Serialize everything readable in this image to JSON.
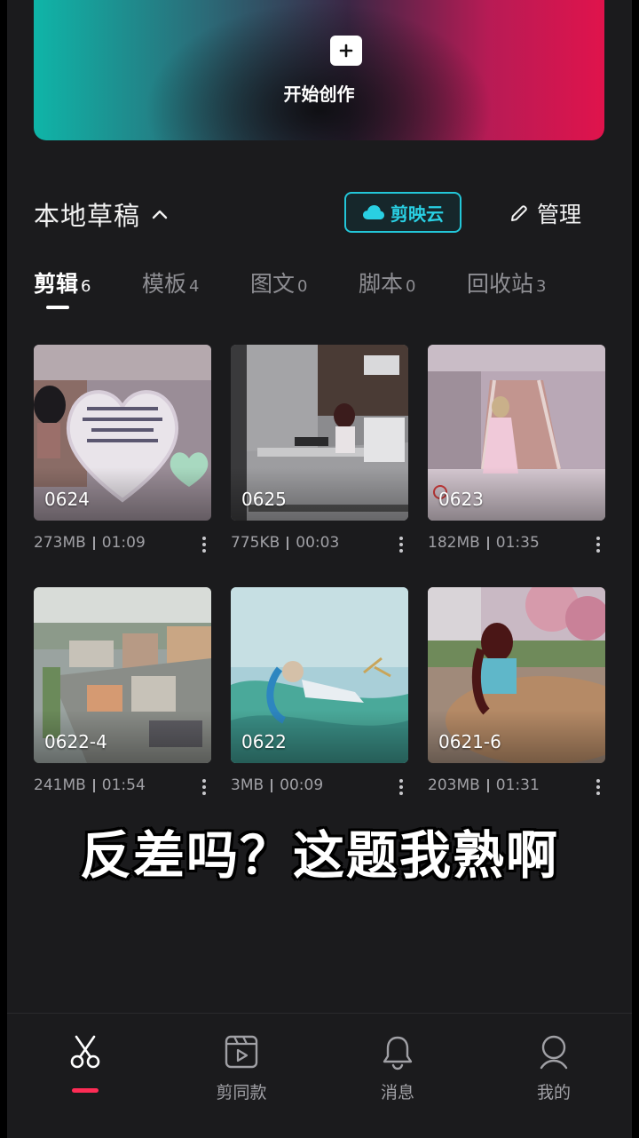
{
  "hero": {
    "label": "开始创作",
    "icon": "plus-icon"
  },
  "section": {
    "title": "本地草稿",
    "cloud_label": "剪映云",
    "manage_label": "管理"
  },
  "tabs": [
    {
      "label": "剪辑",
      "count": "6",
      "active": true
    },
    {
      "label": "模板",
      "count": "4"
    },
    {
      "label": "图文",
      "count": "0"
    },
    {
      "label": "脚本",
      "count": "0"
    },
    {
      "label": "回收站",
      "count": "3"
    }
  ],
  "drafts": [
    {
      "name": "0624",
      "size": "273MB",
      "duration": "01:09"
    },
    {
      "name": "0625",
      "size": "775KB",
      "duration": "00:03"
    },
    {
      "name": "0623",
      "size": "182MB",
      "duration": "01:35"
    },
    {
      "name": "0622-4",
      "size": "241MB",
      "duration": "01:54"
    },
    {
      "name": "0622",
      "size": "3MB",
      "duration": "00:09"
    },
    {
      "name": "0621-6",
      "size": "203MB",
      "duration": "01:31"
    }
  ],
  "caption": "反差吗？这题我熟啊",
  "nav": [
    {
      "label": "",
      "icon": "scissors-icon",
      "active": true
    },
    {
      "label": "剪同款",
      "icon": "video-template-icon"
    },
    {
      "label": "消息",
      "icon": "bell-icon"
    },
    {
      "label": "我的",
      "icon": "profile-icon"
    }
  ],
  "colors": {
    "accent_cyan": "#29d0e3",
    "nav_active": "#fe2c55",
    "background": "#1b1b1d"
  }
}
